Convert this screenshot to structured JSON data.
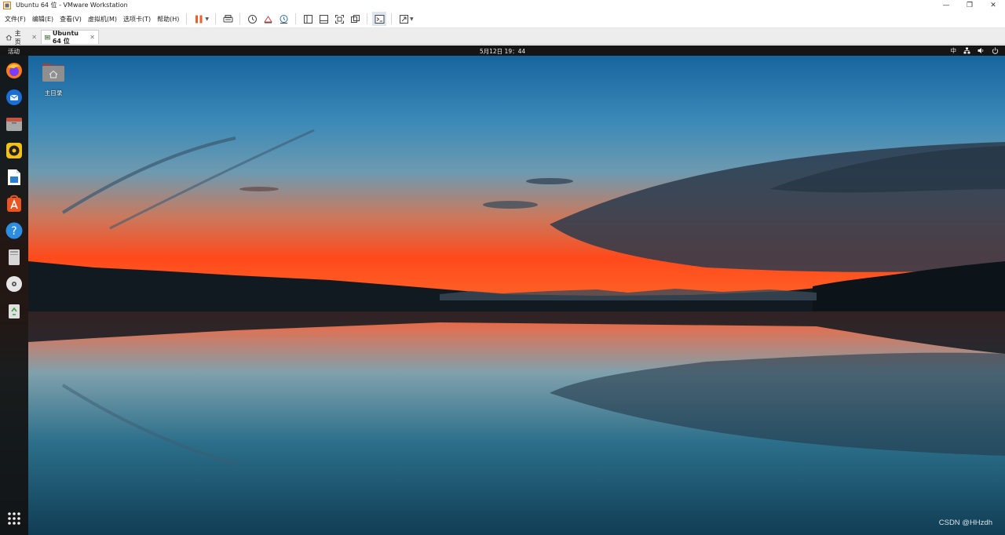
{
  "window": {
    "title": "Ubuntu 64 位 - VMware Workstation",
    "controls": [
      "minimize",
      "restore",
      "close"
    ]
  },
  "menu": {
    "items": [
      "文件(F)",
      "编辑(E)",
      "查看(V)",
      "虚拟机(M)",
      "选项卡(T)",
      "帮助(H)"
    ]
  },
  "toolbar": {
    "icons": [
      "pause-icon",
      "send-ctrl-alt-del-icon",
      "snapshot-icon",
      "revert-snapshot-icon",
      "manage-snapshots-icon",
      "library-view-icon",
      "thumbnail-view-icon",
      "fullscreen-icon",
      "unity-icon",
      "console-view-icon",
      "stretch-guest-icon"
    ]
  },
  "tabs": [
    {
      "label": "主页",
      "active": false
    },
    {
      "label": "Ubuntu 64 位",
      "active": true
    }
  ],
  "ubuntu": {
    "activities": "活动",
    "clock": "5月12日  19：44",
    "input_method": "中",
    "tray_icons": [
      "network-icon",
      "volume-icon",
      "power-icon"
    ],
    "dock_items": [
      "firefox-icon",
      "thunderbird-icon",
      "files-icon",
      "rhythmbox-icon",
      "libreoffice-writer-icon",
      "ubuntu-software-icon",
      "help-icon",
      "removable-drive-icon",
      "dvd-icon",
      "trash-icon",
      "show-applications-icon"
    ],
    "desktop_icons": [
      {
        "label": "主目录",
        "icon": "home-folder-icon"
      }
    ]
  },
  "watermark": "CSDN @HHzdh",
  "colors": {
    "accent_pause": "#e8612c",
    "sky_top": "#1b6fa8",
    "sunset": "#ff4a22"
  }
}
